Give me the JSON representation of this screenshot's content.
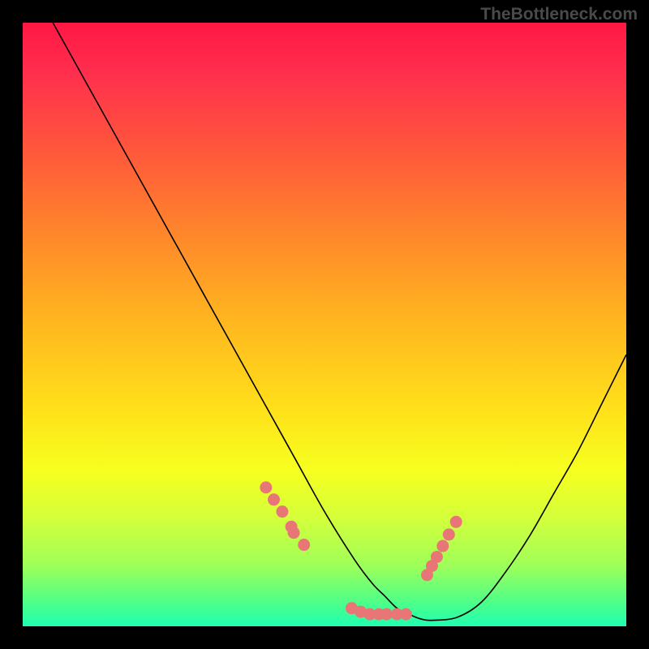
{
  "watermark": "TheBottleneck.com",
  "colors": {
    "dot": "#e97676",
    "curve": "#000000",
    "frame": "#000000"
  },
  "chart_data": {
    "type": "line",
    "title": "",
    "xlabel": "",
    "ylabel": "",
    "xlim": [
      0,
      100
    ],
    "ylim": [
      0,
      100
    ],
    "grid": false,
    "legend": false,
    "series": [
      {
        "name": "bottleneck-curve",
        "x": [
          5,
          10,
          15,
          20,
          25,
          30,
          35,
          40,
          45,
          50,
          55,
          58,
          60,
          62,
          64,
          66,
          68,
          72,
          76,
          80,
          84,
          88,
          92,
          96,
          100
        ],
        "y": [
          100,
          91,
          82,
          73,
          64,
          55,
          46,
          37,
          28,
          19,
          11,
          7,
          5,
          3,
          2,
          1.2,
          1,
          1.5,
          4,
          9,
          15,
          22,
          29,
          37,
          45
        ]
      }
    ],
    "dots": {
      "name": "highlight-points",
      "x": [
        40.3,
        41.6,
        43.0,
        44.5,
        44.9,
        46.6,
        54.5,
        56.0,
        57.5,
        59.0,
        60.3,
        62.0,
        63.5,
        67.0,
        67.8,
        68.6,
        69.6,
        70.6,
        71.8
      ],
      "y": [
        23,
        21,
        19,
        16.5,
        15.5,
        13.5,
        3.0,
        2.4,
        2.0,
        2.0,
        2.0,
        2.0,
        2.0,
        8.5,
        10,
        11.5,
        13.3,
        15.2,
        17.3
      ]
    }
  }
}
